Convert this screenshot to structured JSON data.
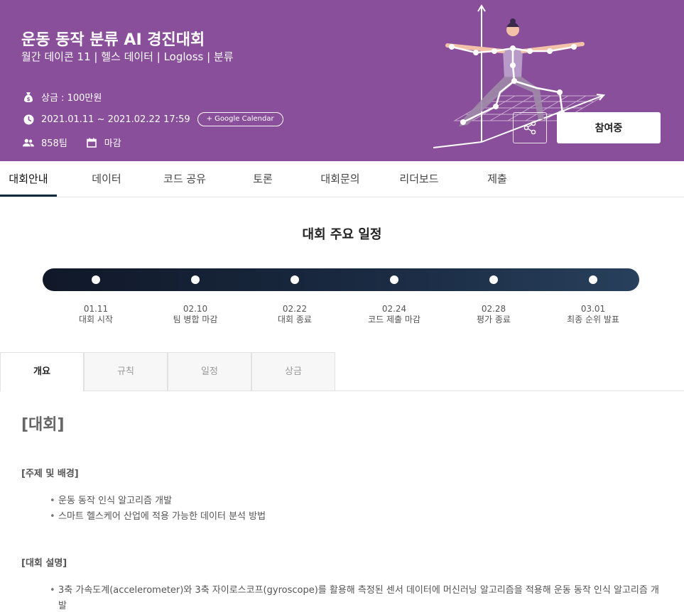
{
  "banner": {
    "title": "운동 동작 분류 AI 경진대회",
    "subtitle": "월간 데이콘 11 | 헬스 데이터 | Logloss | 분류",
    "prize": "상금 : 100만원",
    "period": "2021.01.11 ~ 2021.02.22 17:59",
    "google_calendar": "+ Google Calendar",
    "teams": "858팀",
    "status": "마감",
    "join_label": "참여중",
    "color": "#8a4f9b"
  },
  "main_tabs": [
    "대회안내",
    "데이터",
    "코드 공유",
    "토론",
    "대회문의",
    "리더보드",
    "제출"
  ],
  "schedule": {
    "title": "대회 주요 일정",
    "items": [
      {
        "date": "01.11",
        "label": "대회 시작"
      },
      {
        "date": "02.10",
        "label": "팀 병합 마감"
      },
      {
        "date": "02.22",
        "label": "대회 종료"
      },
      {
        "date": "02.24",
        "label": "코드 제출 마감"
      },
      {
        "date": "02.28",
        "label": "평가 종료"
      },
      {
        "date": "03.01",
        "label": "최종 순위 발표"
      }
    ]
  },
  "sub_tabs": [
    "개요",
    "규칙",
    "일정",
    "상금"
  ],
  "content": {
    "heading": "[대회]",
    "section1_title": "[주제 및 배경]",
    "section1_bullets": [
      "운동 동작 인식 알고리즘 개발",
      "스마트 헬스케어 산업에 적용 가능한 데이터 분석 방법"
    ],
    "section2_title": "[대회 설명]",
    "section2_bullets": [
      "3축 가속도계(accelerometer)와 3축 자이로스코프(gyroscope)를 활용해 측정된 센서 데이터에 머신러닝 알고리즘을 적용해 운동 동작 인식 알고리즘 개발"
    ]
  }
}
